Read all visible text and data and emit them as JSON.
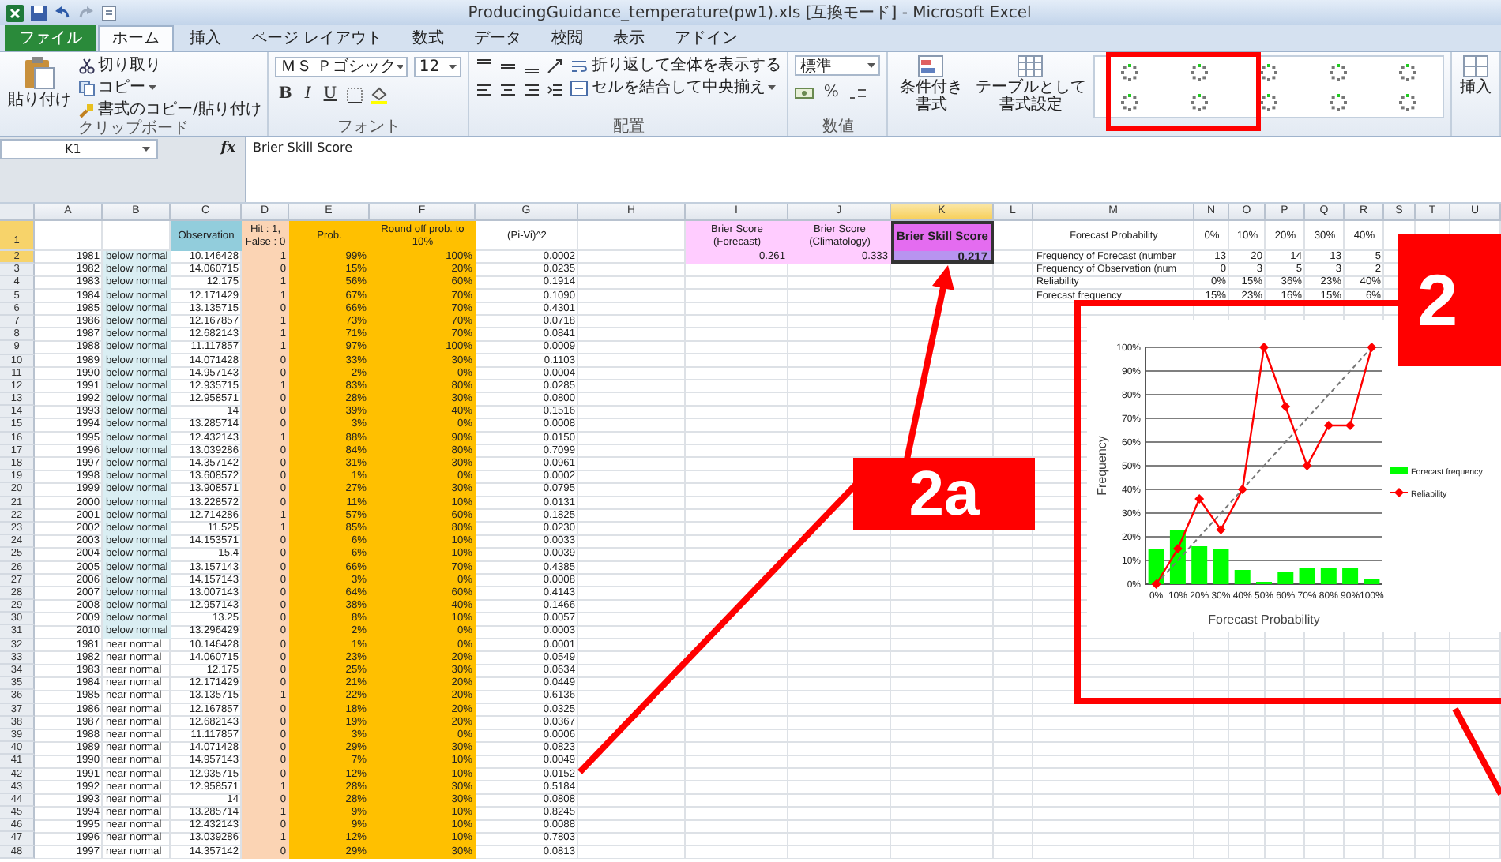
{
  "window": {
    "title": "ProducingGuidance_temperature(pw1).xls [互換モード] - Microsoft Excel"
  },
  "tabs": [
    {
      "label": "ファイル",
      "kind": "file",
      "selected": false
    },
    {
      "label": "ホーム",
      "kind": "tab",
      "selected": true
    },
    {
      "label": "挿入",
      "kind": "tab",
      "selected": false
    },
    {
      "label": "ページ レイアウト",
      "kind": "tab",
      "selected": false
    },
    {
      "label": "数式",
      "kind": "tab",
      "selected": false
    },
    {
      "label": "データ",
      "kind": "tab",
      "selected": false
    },
    {
      "label": "校閲",
      "kind": "tab",
      "selected": false
    },
    {
      "label": "表示",
      "kind": "tab",
      "selected": false
    },
    {
      "label": "アドイン",
      "kind": "tab",
      "selected": false
    }
  ],
  "ribbon": {
    "clipboard": {
      "paste": "貼り付け",
      "cut": "切り取り",
      "copy": "コピー",
      "format_painter": "書式のコピー/貼り付け",
      "label": "クリップボード"
    },
    "font": {
      "name": "ＭＳ Ｐゴシック",
      "size": "12",
      "buttons": [
        "B",
        "I",
        "U"
      ],
      "label": "フォント"
    },
    "alignment": {
      "wrap": "折り返して全体を表示する",
      "merge": "セルを結合して中央揃え",
      "label": "配置"
    },
    "number": {
      "format": "標準",
      "percent": "%",
      "label": "数値"
    },
    "styles": {
      "conditional": "条件付き書式",
      "table": "テーブルとして書式設定"
    },
    "cells": {
      "insert": "挿入"
    }
  },
  "formula_bar": {
    "name_box": "K1",
    "fx": "fx",
    "value": "Brier Skill Score"
  },
  "sheet": {
    "columns": [
      "A",
      "B",
      "C",
      "D",
      "E",
      "F",
      "G",
      "H",
      "I",
      "J",
      "K",
      "L",
      "M",
      "N",
      "O",
      "P",
      "Q",
      "R",
      "S",
      "T",
      "U"
    ],
    "header": {
      "number": "1",
      "observation": "Observation",
      "hit": "Hit : 1, False : 0",
      "prob": "Prob.",
      "rounded": "Round off prob. to 10%",
      "squared_error": "(Pi-Vi)^2"
    },
    "rows": [
      {
        "number": "2",
        "year": "1981",
        "category": "below normal",
        "observation": "10.146428",
        "hit": "1",
        "prob": "99%",
        "rounded": "100%",
        "squared_error": "0.0002",
        "highlighted": true
      },
      {
        "number": "3",
        "year": "1982",
        "category": "below normal",
        "observation": "14.060715",
        "hit": "0",
        "prob": "15%",
        "rounded": "20%",
        "squared_error": "0.0235",
        "highlighted": true
      },
      {
        "number": "4",
        "year": "1983",
        "category": "below normal",
        "observation": "12.175",
        "hit": "1",
        "prob": "56%",
        "rounded": "60%",
        "squared_error": "0.1914",
        "highlighted": true
      },
      {
        "number": "5",
        "year": "1984",
        "category": "below normal",
        "observation": "12.171429",
        "hit": "1",
        "prob": "67%",
        "rounded": "70%",
        "squared_error": "0.1090",
        "highlighted": true
      },
      {
        "number": "6",
        "year": "1985",
        "category": "below normal",
        "observation": "13.135715",
        "hit": "0",
        "prob": "66%",
        "rounded": "70%",
        "squared_error": "0.4301",
        "highlighted": true
      },
      {
        "number": "7",
        "year": "1986",
        "category": "below normal",
        "observation": "12.167857",
        "hit": "1",
        "prob": "73%",
        "rounded": "70%",
        "squared_error": "0.0718",
        "highlighted": true
      },
      {
        "number": "8",
        "year": "1987",
        "category": "below normal",
        "observation": "12.682143",
        "hit": "1",
        "prob": "71%",
        "rounded": "70%",
        "squared_error": "0.0841",
        "highlighted": true
      },
      {
        "number": "9",
        "year": "1988",
        "category": "below normal",
        "observation": "11.117857",
        "hit": "1",
        "prob": "97%",
        "rounded": "100%",
        "squared_error": "0.0009",
        "highlighted": true
      },
      {
        "number": "10",
        "year": "1989",
        "category": "below normal",
        "observation": "14.071428",
        "hit": "0",
        "prob": "33%",
        "rounded": "30%",
        "squared_error": "0.1103",
        "highlighted": true
      },
      {
        "number": "11",
        "year": "1990",
        "category": "below normal",
        "observation": "14.957143",
        "hit": "0",
        "prob": "2%",
        "rounded": "0%",
        "squared_error": "0.0004",
        "highlighted": true
      },
      {
        "number": "12",
        "year": "1991",
        "category": "below normal",
        "observation": "12.935715",
        "hit": "1",
        "prob": "83%",
        "rounded": "80%",
        "squared_error": "0.0285",
        "highlighted": true
      },
      {
        "number": "13",
        "year": "1992",
        "category": "below normal",
        "observation": "12.958571",
        "hit": "0",
        "prob": "28%",
        "rounded": "30%",
        "squared_error": "0.0800",
        "highlighted": true
      },
      {
        "number": "14",
        "year": "1993",
        "category": "below normal",
        "observation": "14",
        "hit": "0",
        "prob": "39%",
        "rounded": "40%",
        "squared_error": "0.1516",
        "highlighted": true
      },
      {
        "number": "15",
        "year": "1994",
        "category": "below normal",
        "observation": "13.285714",
        "hit": "0",
        "prob": "3%",
        "rounded": "0%",
        "squared_error": "0.0008",
        "highlighted": true
      },
      {
        "number": "16",
        "year": "1995",
        "category": "below normal",
        "observation": "12.432143",
        "hit": "1",
        "prob": "88%",
        "rounded": "90%",
        "squared_error": "0.0150",
        "highlighted": true
      },
      {
        "number": "17",
        "year": "1996",
        "category": "below normal",
        "observation": "13.039286",
        "hit": "0",
        "prob": "84%",
        "rounded": "80%",
        "squared_error": "0.7099",
        "highlighted": true
      },
      {
        "number": "18",
        "year": "1997",
        "category": "below normal",
        "observation": "14.357142",
        "hit": "0",
        "prob": "31%",
        "rounded": "30%",
        "squared_error": "0.0961",
        "highlighted": true
      },
      {
        "number": "19",
        "year": "1998",
        "category": "below normal",
        "observation": "13.608572",
        "hit": "0",
        "prob": "1%",
        "rounded": "0%",
        "squared_error": "0.0002",
        "highlighted": true
      },
      {
        "number": "20",
        "year": "1999",
        "category": "below normal",
        "observation": "13.908571",
        "hit": "0",
        "prob": "27%",
        "rounded": "30%",
        "squared_error": "0.0795",
        "highlighted": true
      },
      {
        "number": "21",
        "year": "2000",
        "category": "below normal",
        "observation": "13.228572",
        "hit": "0",
        "prob": "11%",
        "rounded": "10%",
        "squared_error": "0.0131",
        "highlighted": true
      },
      {
        "number": "22",
        "year": "2001",
        "category": "below normal",
        "observation": "12.714286",
        "hit": "1",
        "prob": "57%",
        "rounded": "60%",
        "squared_error": "0.1825",
        "highlighted": true
      },
      {
        "number": "23",
        "year": "2002",
        "category": "below normal",
        "observation": "11.525",
        "hit": "1",
        "prob": "85%",
        "rounded": "80%",
        "squared_error": "0.0230",
        "highlighted": true
      },
      {
        "number": "24",
        "year": "2003",
        "category": "below normal",
        "observation": "14.153571",
        "hit": "0",
        "prob": "6%",
        "rounded": "10%",
        "squared_error": "0.0033",
        "highlighted": true
      },
      {
        "number": "25",
        "year": "2004",
        "category": "below normal",
        "observation": "15.4",
        "hit": "0",
        "prob": "6%",
        "rounded": "10%",
        "squared_error": "0.0039",
        "highlighted": true
      },
      {
        "number": "26",
        "year": "2005",
        "category": "below normal",
        "observation": "13.157143",
        "hit": "0",
        "prob": "66%",
        "rounded": "70%",
        "squared_error": "0.4385",
        "highlighted": true
      },
      {
        "number": "27",
        "year": "2006",
        "category": "below normal",
        "observation": "14.157143",
        "hit": "0",
        "prob": "3%",
        "rounded": "0%",
        "squared_error": "0.0008",
        "highlighted": true
      },
      {
        "number": "28",
        "year": "2007",
        "category": "below normal",
        "observation": "13.007143",
        "hit": "0",
        "prob": "64%",
        "rounded": "60%",
        "squared_error": "0.4143",
        "highlighted": true
      },
      {
        "number": "29",
        "year": "2008",
        "category": "below normal",
        "observation": "12.957143",
        "hit": "0",
        "prob": "38%",
        "rounded": "40%",
        "squared_error": "0.1466",
        "highlighted": true
      },
      {
        "number": "30",
        "year": "2009",
        "category": "below normal",
        "observation": "13.25",
        "hit": "0",
        "prob": "8%",
        "rounded": "10%",
        "squared_error": "0.0057",
        "highlighted": true
      },
      {
        "number": "31",
        "year": "2010",
        "category": "below normal",
        "observation": "13.296429",
        "hit": "0",
        "prob": "2%",
        "rounded": "0%",
        "squared_error": "0.0003",
        "highlighted": true
      },
      {
        "number": "32",
        "year": "1981",
        "category": "near normal",
        "observation": "10.146428",
        "hit": "0",
        "prob": "1%",
        "rounded": "0%",
        "squared_error": "0.0001",
        "highlighted": false
      },
      {
        "number": "33",
        "year": "1982",
        "category": "near normal",
        "observation": "14.060715",
        "hit": "0",
        "prob": "23%",
        "rounded": "20%",
        "squared_error": "0.0549",
        "highlighted": false
      },
      {
        "number": "34",
        "year": "1983",
        "category": "near normal",
        "observation": "12.175",
        "hit": "0",
        "prob": "25%",
        "rounded": "30%",
        "squared_error": "0.0634",
        "highlighted": false
      },
      {
        "number": "35",
        "year": "1984",
        "category": "near normal",
        "observation": "12.171429",
        "hit": "0",
        "prob": "21%",
        "rounded": "20%",
        "squared_error": "0.0449",
        "highlighted": false
      },
      {
        "number": "36",
        "year": "1985",
        "category": "near normal",
        "observation": "13.135715",
        "hit": "1",
        "prob": "22%",
        "rounded": "20%",
        "squared_error": "0.6136",
        "highlighted": false
      },
      {
        "number": "37",
        "year": "1986",
        "category": "near normal",
        "observation": "12.167857",
        "hit": "0",
        "prob": "18%",
        "rounded": "20%",
        "squared_error": "0.0325",
        "highlighted": false
      },
      {
        "number": "38",
        "year": "1987",
        "category": "near normal",
        "observation": "12.682143",
        "hit": "0",
        "prob": "19%",
        "rounded": "20%",
        "squared_error": "0.0367",
        "highlighted": false
      },
      {
        "number": "39",
        "year": "1988",
        "category": "near normal",
        "observation": "11.117857",
        "hit": "0",
        "prob": "3%",
        "rounded": "0%",
        "squared_error": "0.0006",
        "highlighted": false
      },
      {
        "number": "40",
        "year": "1989",
        "category": "near normal",
        "observation": "14.071428",
        "hit": "0",
        "prob": "29%",
        "rounded": "30%",
        "squared_error": "0.0823",
        "highlighted": false
      },
      {
        "number": "41",
        "year": "1990",
        "category": "near normal",
        "observation": "14.957143",
        "hit": "0",
        "prob": "7%",
        "rounded": "10%",
        "squared_error": "0.0049",
        "highlighted": false
      },
      {
        "number": "42",
        "year": "1991",
        "category": "near normal",
        "observation": "12.935715",
        "hit": "0",
        "prob": "12%",
        "rounded": "10%",
        "squared_error": "0.0152",
        "highlighted": false
      },
      {
        "number": "43",
        "year": "1992",
        "category": "near normal",
        "observation": "12.958571",
        "hit": "1",
        "prob": "28%",
        "rounded": "30%",
        "squared_error": "0.5184",
        "highlighted": false
      },
      {
        "number": "44",
        "year": "1993",
        "category": "near normal",
        "observation": "14",
        "hit": "0",
        "prob": "28%",
        "rounded": "30%",
        "squared_error": "0.0808",
        "highlighted": false
      },
      {
        "number": "45",
        "year": "1994",
        "category": "near normal",
        "observation": "13.285714",
        "hit": "1",
        "prob": "9%",
        "rounded": "10%",
        "squared_error": "0.8245",
        "highlighted": false
      },
      {
        "number": "46",
        "year": "1995",
        "category": "near normal",
        "observation": "12.432143",
        "hit": "0",
        "prob": "9%",
        "rounded": "10%",
        "squared_error": "0.0088",
        "highlighted": false
      },
      {
        "number": "47",
        "year": "1996",
        "category": "near normal",
        "observation": "13.039286",
        "hit": "1",
        "prob": "12%",
        "rounded": "10%",
        "squared_error": "0.7803",
        "highlighted": false
      },
      {
        "number": "48",
        "year": "1997",
        "category": "near normal",
        "observation": "14.357142",
        "hit": "0",
        "prob": "29%",
        "rounded": "30%",
        "squared_error": "0.0813",
        "highlighted": false
      }
    ]
  },
  "scores": [
    {
      "label": "Brier Score (Forecast)",
      "value": "0.261",
      "kind": "forecast",
      "selected": false
    },
    {
      "label": "Brier Score (Climatology)",
      "value": "0.333",
      "kind": "climatology",
      "selected": false
    },
    {
      "label": "Brier Skill Score",
      "value": "0.217",
      "kind": "skill",
      "selected": true
    }
  ],
  "summary": [
    {
      "label": "Forecast Probability",
      "values": [
        "0%",
        "10%",
        "20%",
        "30%",
        "40%"
      ]
    },
    {
      "label": "Frequency of Forecast (number",
      "values": [
        "13",
        "20",
        "14",
        "13",
        "5"
      ]
    },
    {
      "label": "Frequency of Observation (num",
      "values": [
        "0",
        "3",
        "5",
        "3",
        "2"
      ]
    },
    {
      "label": "Reliability",
      "values": [
        "0%",
        "15%",
        "36%",
        "23%",
        "40%"
      ]
    },
    {
      "label": "Forecast frequency",
      "values": [
        "15%",
        "23%",
        "16%",
        "15%",
        "6%"
      ]
    }
  ],
  "chart": {
    "chart_data": {
      "type": "bar",
      "xlabel": "Forecast Probability",
      "ylabel": "Frequency",
      "categories": [
        "0%",
        "10%",
        "20%",
        "30%",
        "40%",
        "50%",
        "60%",
        "70%",
        "80%",
        "90%",
        "100%"
      ],
      "series": [
        {
          "name": "Forecast frequency",
          "type": "bar",
          "color": "#00ff00",
          "values": [
            15,
            23,
            16,
            15,
            6,
            1,
            5,
            7,
            7,
            7,
            2
          ]
        },
        {
          "name": "Reliability",
          "type": "line",
          "color": "#ff0000",
          "marker": "diamond",
          "values": [
            0,
            15,
            36,
            23,
            40,
            100,
            75,
            50,
            67,
            67,
            100
          ]
        }
      ],
      "ylim": [
        0,
        100
      ],
      "grid": true,
      "legend": "right",
      "yticks": [
        {
          "value": 0,
          "label": "0%"
        },
        {
          "value": 10,
          "label": "10%"
        },
        {
          "value": 20,
          "label": "20%"
        },
        {
          "value": 30,
          "label": "30%"
        },
        {
          "value": 40,
          "label": "40%"
        },
        {
          "value": 50,
          "label": "50%"
        },
        {
          "value": 60,
          "label": "60%"
        },
        {
          "value": 70,
          "label": "70%"
        },
        {
          "value": 80,
          "label": "80%"
        },
        {
          "value": 90,
          "label": "90%"
        },
        {
          "value": 100,
          "label": "100%"
        }
      ]
    }
  },
  "annotations": [
    {
      "label": "2a",
      "kind": "label-a"
    },
    {
      "label": "2",
      "kind": "label-b"
    }
  ]
}
